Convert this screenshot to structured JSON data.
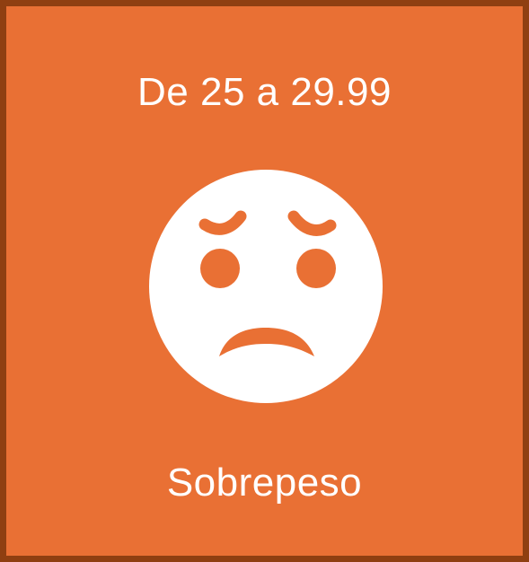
{
  "card": {
    "range_text": "De 25 a 29.99",
    "category_label": "Sobrepeso",
    "icon": "worried-face-icon",
    "background_color": "#e97034",
    "border_color": "#8f3f11",
    "text_color": "#ffffff"
  }
}
